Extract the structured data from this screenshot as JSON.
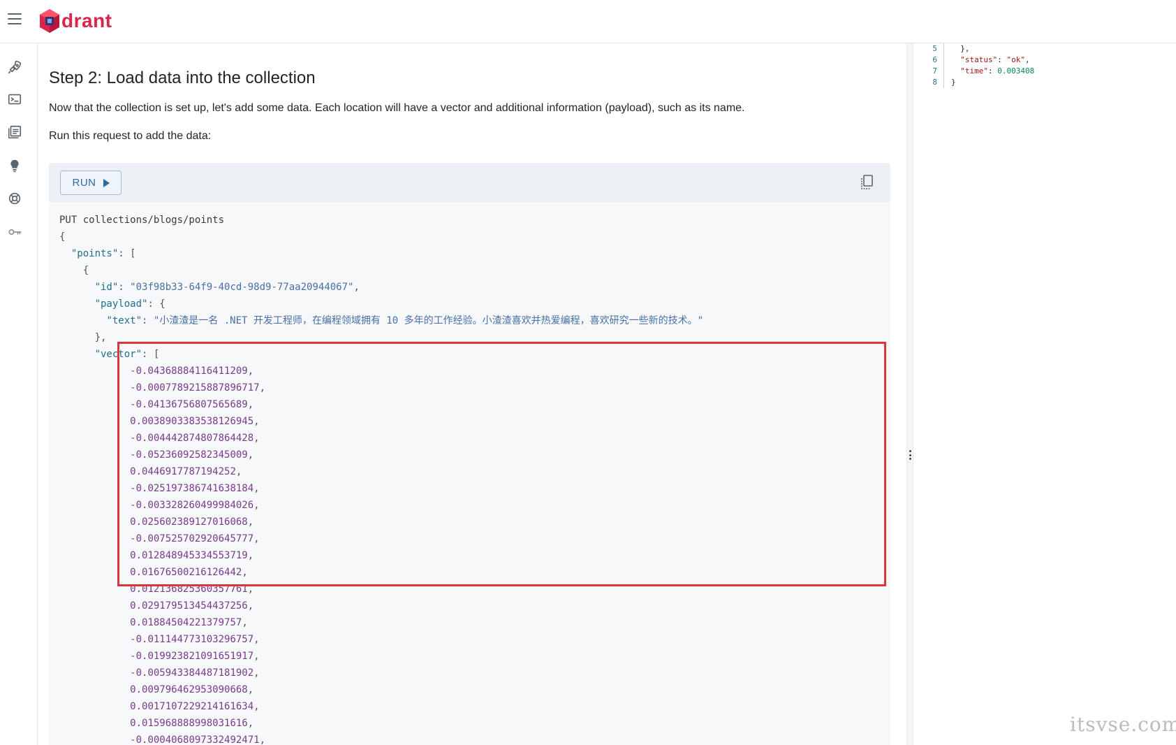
{
  "app": {
    "name": "drant",
    "logo_letter": "Q"
  },
  "rail": {
    "icons": [
      "rocket-icon",
      "console-icon",
      "collections-icon",
      "tutorial-icon",
      "datasets-icon",
      "api-key-icon"
    ]
  },
  "main": {
    "title": "Step 2: Load data into the collection",
    "paragraph1": "Now that the collection is set up, let's add some data. Each location will have a vector and additional information (payload), such as its name.",
    "paragraph2": "Run this request to add the data:",
    "run_label": "RUN",
    "request": {
      "method_line": "PUT collections/blogs/points",
      "id": "03f98b33-64f9-40cd-98d9-77aa20944067",
      "text": "小渣渣是一名 .NET 开发工程师，在编程领域拥有 10 多年的工作经验。小渣渣喜欢并热爱编程，喜欢研究一些新的技术。",
      "vector": [
        "-0.04368884116411209",
        "-0.0007789215887896717",
        "-0.04136756807565689",
        "0.0038903383538126945",
        "-0.004442874807864428",
        "-0.05236092582345009",
        "0.0446917787194252",
        "-0.025197386741638184",
        "-0.003328260499984026",
        "0.025602389127016068",
        "-0.007525702920645777",
        "0.012848945334553719",
        "0.01676500216126442",
        "0.012136825360357761",
        "0.029179513454437256",
        "0.01884504221379757",
        "-0.011144773103296757",
        "-0.019923821091651917",
        "-0.005943384487181902",
        "0.009796462953090668",
        "0.0017107229214161634",
        "0.015968888998031616",
        "-0.0004068097332492471"
      ]
    }
  },
  "response": {
    "lines": [
      {
        "ln": "5",
        "text": "  },",
        "type": "punct"
      },
      {
        "ln": "6",
        "key": "status",
        "value": "ok",
        "type": "str"
      },
      {
        "ln": "7",
        "key": "time",
        "value": "0.003408",
        "type": "num"
      },
      {
        "ln": "8",
        "text": "}",
        "type": "punct"
      }
    ]
  },
  "watermark": "itsvse.com"
}
